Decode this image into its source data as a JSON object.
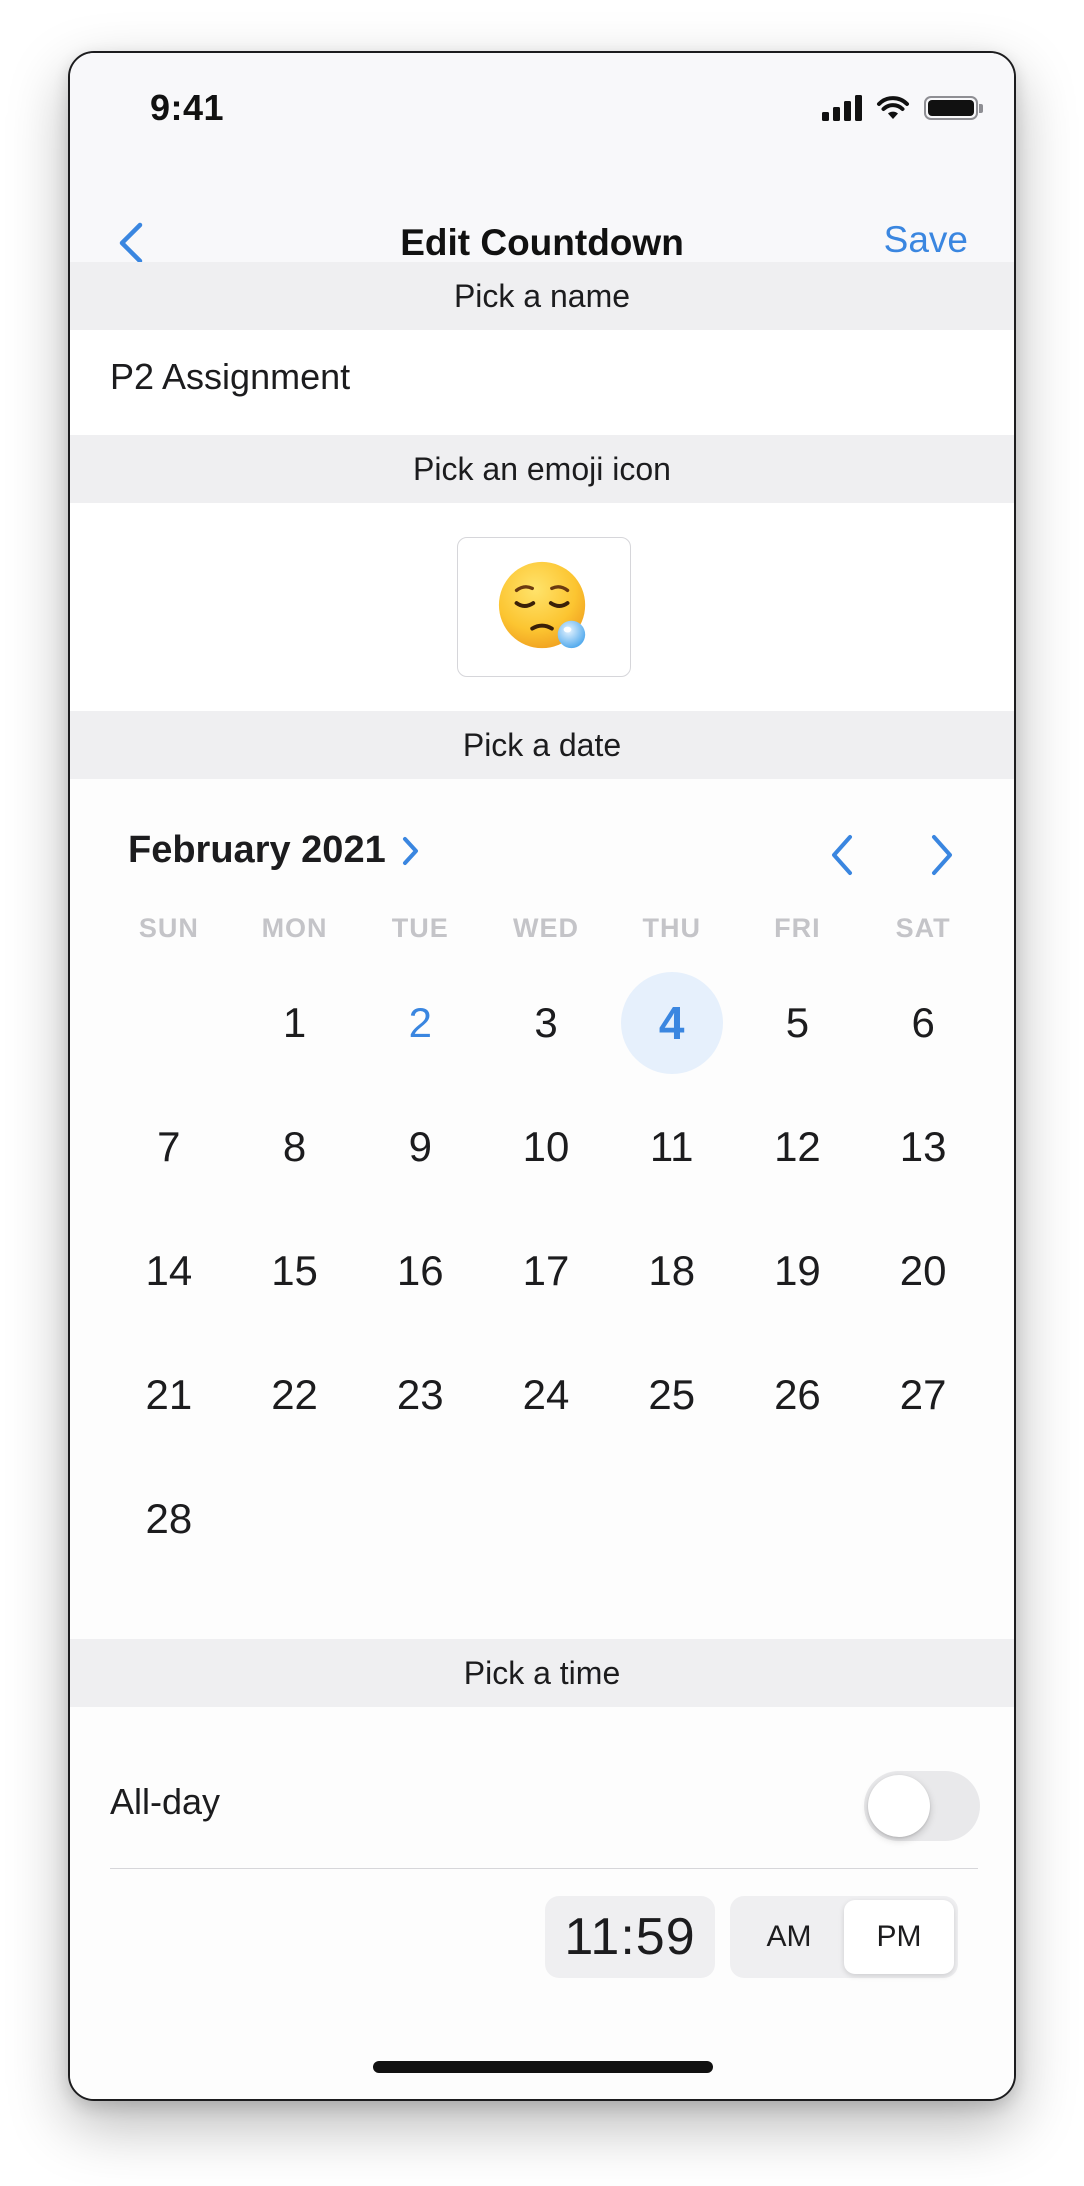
{
  "status_bar": {
    "time": "9:41",
    "icons": [
      "signal-icon",
      "wifi-icon",
      "battery-icon"
    ]
  },
  "nav": {
    "back_icon": "chevron-left-icon",
    "title": "Edit Countdown",
    "save_label": "Save"
  },
  "sections": {
    "name_header": "Pick a name",
    "emoji_header": "Pick an emoji icon",
    "date_header": "Pick a date",
    "time_header": "Pick a time"
  },
  "name": {
    "value": "P2 Assignment"
  },
  "emoji": {
    "selected": "😪"
  },
  "calendar": {
    "month_label": "February 2021",
    "weekdays": [
      "SUN",
      "MON",
      "TUE",
      "WED",
      "THU",
      "FRI",
      "SAT"
    ],
    "leading_blanks": 1,
    "days": [
      "1",
      "2",
      "3",
      "4",
      "5",
      "6",
      "7",
      "8",
      "9",
      "10",
      "11",
      "12",
      "13",
      "14",
      "15",
      "16",
      "17",
      "18",
      "19",
      "20",
      "21",
      "22",
      "23",
      "24",
      "25",
      "26",
      "27",
      "28"
    ],
    "today": "2",
    "selected": "4"
  },
  "time": {
    "allday_label": "All-day",
    "allday_on": false,
    "value": "11:59",
    "am_label": "AM",
    "pm_label": "PM",
    "period_selected": "PM"
  },
  "colors": {
    "accent": "#3a86e0",
    "section_bg": "#efeff1",
    "selected_day_bg": "#e6f0fc"
  }
}
